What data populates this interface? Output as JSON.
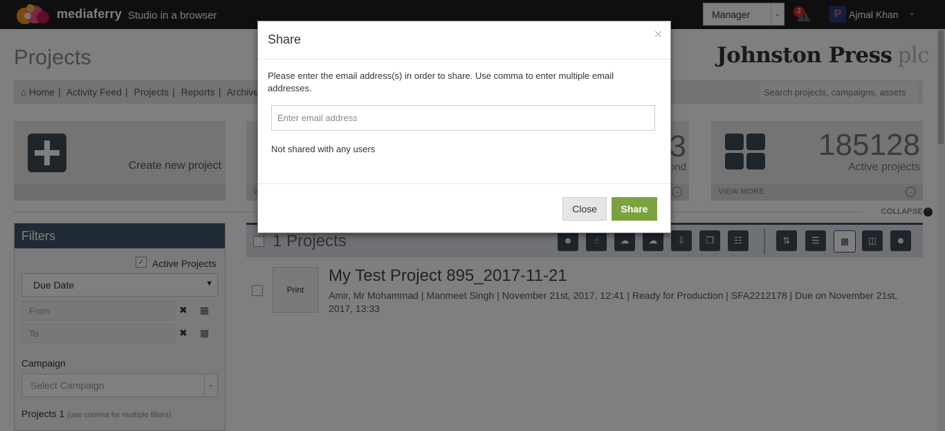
{
  "header": {
    "brand": "mediaferry",
    "brand_sub": "Studio in a browser",
    "role": "Manager",
    "alert_count": "2",
    "avatar_letter": "P",
    "user_name": "Ajmal Khan"
  },
  "page": {
    "title": "Projects",
    "company": "Johnston Press",
    "company_suffix": "plc"
  },
  "breadcrumb": [
    "Home",
    "Activity Feed",
    "Projects",
    "Reports",
    "Archive"
  ],
  "search": {
    "placeholder": "Search projects, campaigns, assets"
  },
  "tiles": {
    "create_label": "Create new project",
    "mid_number_partial": "3",
    "mid_label_partial": "ond",
    "mid_view_more_partial": "V",
    "active_count": "185128",
    "active_label": "Active projects",
    "view_more": "VIEW MORE"
  },
  "collapse_label": "COLLAPSE",
  "filters": {
    "title": "Filters",
    "active_projects_label": "Active Projects",
    "sort_select": "Due Date",
    "from_placeholder": "From",
    "to_placeholder": "To",
    "campaign_label": "Campaign",
    "campaign_select": "Select Campaign",
    "projects_label": "Projects 1",
    "projects_hint": "(use comma for multiple filters)"
  },
  "project_list": {
    "count_label": "1 Projects",
    "items": [
      {
        "thumb_label": "Print",
        "title": "My Test Project 895_2017-11-21",
        "meta": "Amir, Mr Mohammad | Manmeet Singh | November 21st, 2017, 12:41 | Ready for Production | SFA2212178 | Due on November 21st, 2017, 13:33"
      }
    ]
  },
  "modal": {
    "title": "Share",
    "close_glyph": "×",
    "description": "Please enter the email address(s) in order to share. Use comma to enter multiple email addresses.",
    "email_placeholder": "Enter email address",
    "email_value": "",
    "status": "Not shared with any users",
    "close_button": "Close",
    "share_button": "Share"
  },
  "colors": {
    "topbar": "#1f1f1f",
    "accent_dark": "#415468",
    "share_green": "#7ba23f",
    "alert_red": "#d9262c"
  }
}
